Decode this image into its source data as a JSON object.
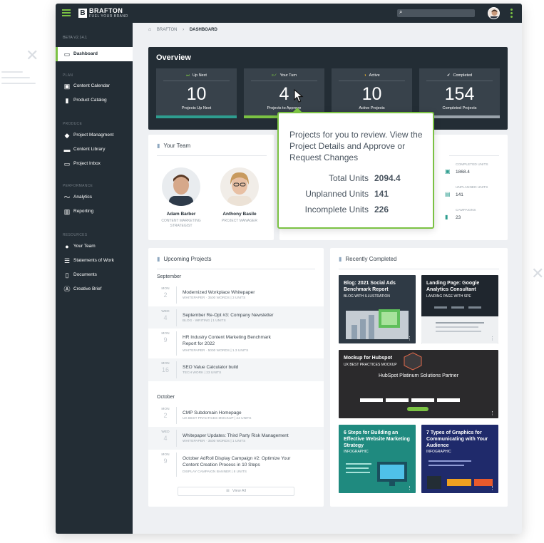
{
  "topbar": {
    "logo_letter": "B",
    "brand": "BRAFTON",
    "tagline": "FUEL YOUR BRAND",
    "search_icon": "search-icon"
  },
  "sidebar": {
    "version": "BETA V2.14.1",
    "dashboard": "Dashboard",
    "sections": {
      "plan": "PLAN",
      "produce": "PRODUCE",
      "performance": "PERFORMANCE",
      "resources": "RESOURCES"
    },
    "items": {
      "content_calendar": "Content Calendar",
      "product_catalog": "Product Catalog",
      "project_management": "Project Managment",
      "content_library": "Content Library",
      "project_inbox": "Project Inbox",
      "analytics": "Analytics",
      "reporting": "Reporting",
      "your_team": "Your Team",
      "statements_of_work": "Statements of Work",
      "documents": "Documents",
      "creative_brief": "Creative Brief"
    }
  },
  "breadcrumb": {
    "root": "BRAFTON",
    "sep": "›",
    "current": "DASHBOARD"
  },
  "overview": {
    "title": "Overview",
    "stats": [
      {
        "head": "Up Next",
        "value": "10",
        "label": "Projects Up Next",
        "bar_color": "#2e9d8f",
        "bar_fill": 1.0
      },
      {
        "head": "Your Turn",
        "value": "4",
        "label": "Projects to Approve",
        "bar_color": "#7bc243",
        "bar_fill": 0.66
      },
      {
        "head": "Active",
        "value": "10",
        "label": "Active Projects",
        "bar_color": "#9aa3ab",
        "bar_fill": 0.0
      },
      {
        "head": "Completed",
        "value": "154",
        "label": "Completed Projects",
        "bar_color": "#9aa3ab",
        "bar_fill": 0.0
      }
    ]
  },
  "team": {
    "title": "Your Team",
    "members": [
      {
        "name": "Adam Barber",
        "role": "CONTENT MARKETING STRATEGIST"
      },
      {
        "name": "Anthony Basile",
        "role": "PROJECT MANAGER"
      }
    ]
  },
  "units": {
    "completed_label": "COMPLETED UNITS",
    "completed_value": "1868.4",
    "unplanned_label": "UNPLANNED UNITS",
    "unplanned_value": "141",
    "campaigns_label": "CAMPAIGNS",
    "campaigns_value": "23"
  },
  "tooltip": {
    "message": "Projects for you to review. View the Project Details and Approve or Request Changes",
    "total_label": "Total Units",
    "total_value": "2094.4",
    "unplanned_label": "Unplanned Units",
    "unplanned_value": "141",
    "incomplete_label": "Incomplete Units",
    "incomplete_value": "226"
  },
  "upcoming": {
    "title": "Upcoming Projects",
    "months": [
      "September",
      "October"
    ],
    "projects": [
      {
        "dow": "MON",
        "day": "2",
        "title": "Modernized Workplace Whitepaper",
        "meta": "WHITEPAPER · 3500 WORDS | 3 UNITS"
      },
      {
        "dow": "WED",
        "day": "4",
        "title": "September Re-Opt #3: Company Newsletter",
        "meta": "BLOG · WRITING | 1 UNITS"
      },
      {
        "dow": "MON",
        "day": "9",
        "title": "HR Industry Content Marketing Benchmark Report for 2022",
        "meta": "WHITEPAPER · 5000 WORDS | 1.3 UNITS"
      },
      {
        "dow": "MON",
        "day": "16",
        "title": "SEO Value Calculator build",
        "meta": "TECH WORK | 23 UNITS"
      },
      {
        "dow": "MON",
        "day": "2",
        "title": "CMP Subdomain Homepage",
        "meta": "UX BEST PRACTICES MOCKUP | 24 UNITS"
      },
      {
        "dow": "WED",
        "day": "4",
        "title": "Whitepaper Updates: Third Party Risk Management",
        "meta": "WHITEPAPER · 3500 WORDS | 1 UNITS"
      },
      {
        "dow": "MON",
        "day": "9",
        "title": "October AdRoll Display Campaign #2: Optimize Your Content Creation Process in 10 Steps",
        "meta": "DISPLAY CAMPAIGN BANNER | 8 UNITS"
      }
    ],
    "view_all": "View All"
  },
  "recent": {
    "title": "Recently Completed",
    "items": [
      {
        "title": "Blog: 2021 Social Ads Benchmark Report",
        "sub": "BLOG WITH ILLUSTRATION"
      },
      {
        "title": "Landing Page: Google Analytics Consultant",
        "sub": "LANDING PAGE WITH SPE"
      },
      {
        "title": "Mockup for Hubspot",
        "sub": "UX BEST PRACTICES MOCKUP",
        "inner": "HubSpot Platinum Solutions Partner"
      },
      {
        "title": "6 Steps for Building an Effective Website Marketing Strategy",
        "sub": "INFOGRAPHIC"
      },
      {
        "title": "7 Types of Graphics for Communicating with Your Audience",
        "sub": "INFOGRAPHIC"
      }
    ]
  }
}
